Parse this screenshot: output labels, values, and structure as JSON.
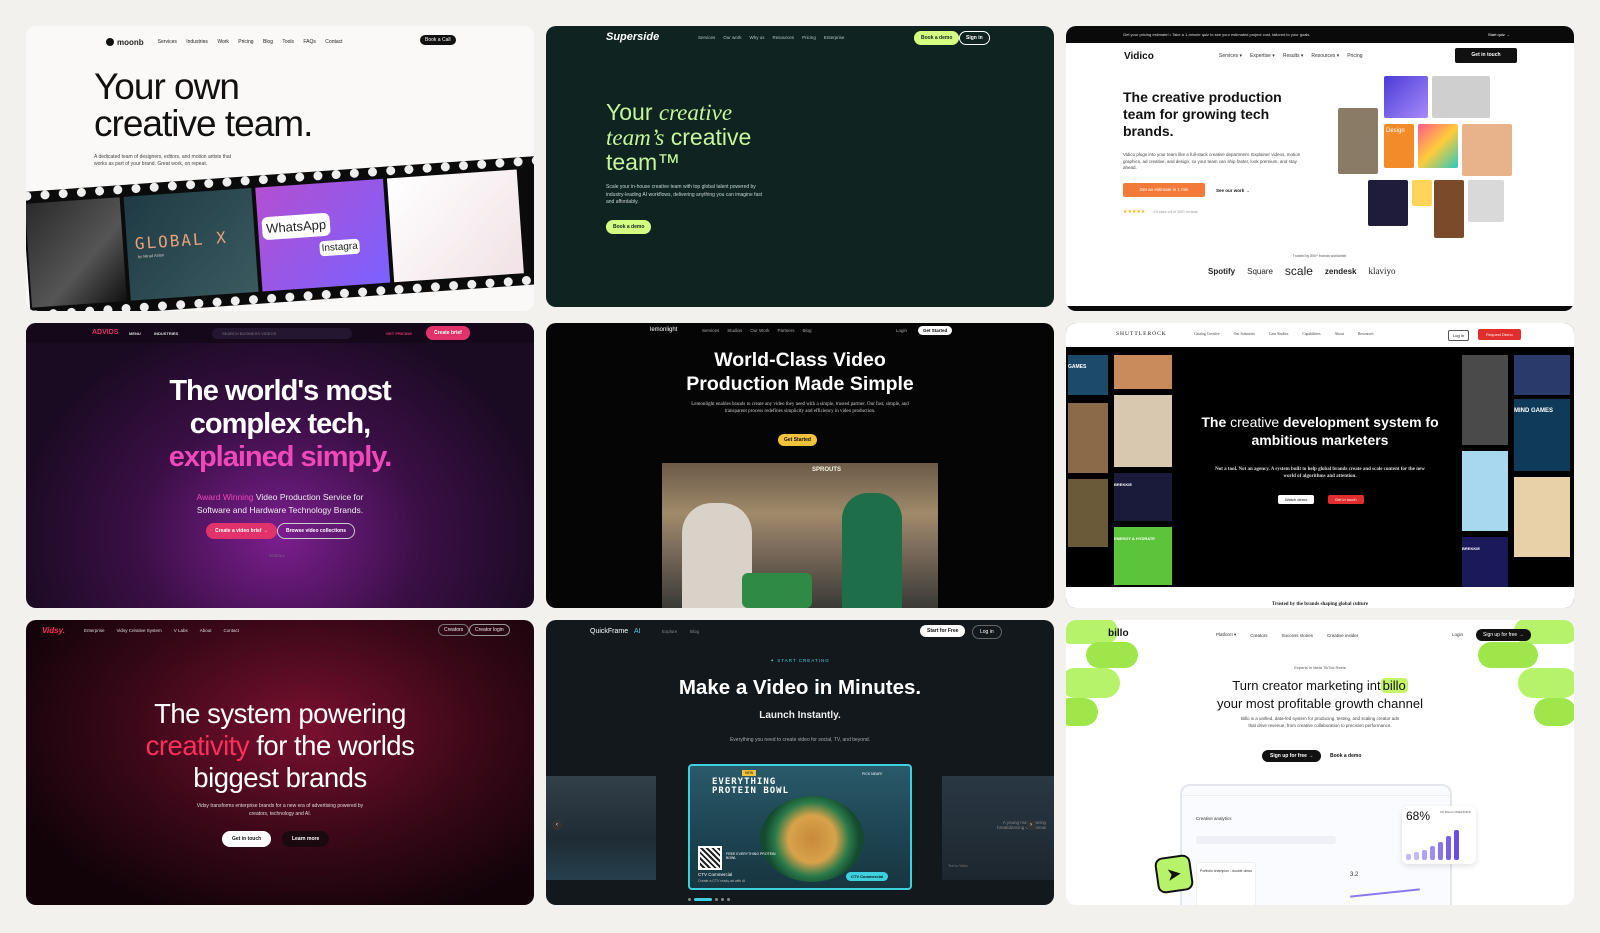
{
  "c1": {
    "logo": "moonb",
    "nav": [
      "Services",
      "Industries",
      "Work",
      "Pricing",
      "Blog",
      "Tools",
      "FAQs",
      "Contact"
    ],
    "cta": "Book a Call",
    "h1a": "Your own",
    "h1b": "creative team.",
    "sub": "A dedicated team of designers, editors, and motion artists that works as part of your brand. Great work, on repeat.",
    "frame2": "GLOBAL X",
    "frame2sub": "by Mirad Aslan",
    "frame3a": "WhatsApp",
    "frame3b": "Instagra"
  },
  "c2": {
    "logo": "Superside",
    "nav": [
      "Services",
      "Our work",
      "Why us",
      "Resources",
      "Pricing",
      "Enterprise"
    ],
    "cta1": "Book a demo",
    "cta2": "Sign in",
    "h1a": "Your ",
    "h1b": "creative",
    "h1c": "team’s",
    "h1d": " creative",
    "h1e": "team™",
    "sub": "Scale your in-house creative team with top global talent powered by industry-leading AI workflows, delivering anything you can imagine fast and affordably.",
    "btn": "Book a demo"
  },
  "c3": {
    "banner": "Get your pricing estimate! • Take a 1-minute quiz to see your estimated project cost, tailored to your goals.",
    "banner_cta": "Start quiz →",
    "logo": "Vidico",
    "nav": [
      "Services ▾",
      "Expertise ▾",
      "Results ▾",
      "Resources ▾",
      "Pricing"
    ],
    "cta": "Get in touch",
    "h1": "The creative production team for growing tech brands.",
    "sub": "Vidico plugs into your team like a full-stack creative department. Explainer videos, motion graphics, ad creative, and design, so your team can ship faster, look premium, and stay ahead.",
    "btn1": "Get an estimate in 1 min",
    "btn2": "See our work →",
    "rating": "★★★★★",
    "rating_text": "4.9 stars out of 100+ reviews",
    "trusted": "Trusted by 500+ brands worldwide.",
    "logos": [
      "Spotify",
      "Square",
      "scale",
      "zendesk",
      "klaviyo"
    ],
    "tile": "Design"
  },
  "c4": {
    "logo": "ADVIDS",
    "menu": "MENU",
    "industries": "INDUSTRIES",
    "search": "SEARCH BUSINESS VIDEOS",
    "pricing": "GET PRICING",
    "cta": "Create brief",
    "h1a": "The world's most",
    "h1b": "complex tech,",
    "h1c": "explained simply.",
    "sub1": "Award Winning",
    "sub2": " Video Production Service for",
    "sub3": "Software and Hardware Technology Brands.",
    "btn1": "Create a video brief →",
    "btn2": "Browse video collections",
    "scroll": "SCROLL"
  },
  "c5": {
    "logo": "lemonlight",
    "nav": [
      "Services",
      "Studios",
      "Our Work",
      "Partners",
      "Blog"
    ],
    "login": "Login",
    "cta": "Get Started",
    "h1a": "World-Class Video",
    "h1b": "Production Made Simple",
    "sub": "Lemonlight enables brands to create any video they need with a simple, trusted partner. Our fast, simple, and transparent process redefines simplicity and efficiency in video production.",
    "btn": "Get Started",
    "sign": "SPROUTS"
  },
  "c6": {
    "logo": "SHUTTLEROCK",
    "nav": [
      "Catalog Creative",
      "Our Solutions",
      "Case Studies",
      "Capabilities",
      "About",
      "Resources"
    ],
    "login": "Log In",
    "cta": "Request Demo",
    "h1a": "The ",
    "h1b": "creative",
    "h1c": " development system fo",
    "h1d": "ambitious marketers",
    "sub": "Not a tool. Not an agency. A system built to help global brands create and scale content for the new world of algorithms and attention.",
    "btn1": "Watch demo",
    "btn2": "Get in touch",
    "trusted": "Trusted by the brands shaping global culture",
    "tiles": [
      "GAMES",
      "BREKKIE",
      "MIND GAMES",
      "ENERGY & HYDRATE",
      "BREKKIE"
    ]
  },
  "c7": {
    "logo": "Vidsy.",
    "nav": [
      "Enterprise",
      "Vidsy Creative System",
      "V Labs",
      "About",
      "Contact"
    ],
    "btn_creators": "Creators",
    "btn_login": "Creator login",
    "h1a": "The system powering",
    "h1b": "creativity",
    "h1c": " for the worlds",
    "h1d": "biggest brands",
    "sub": "Vidsy transforms enterprise brands for a new era of advertising powered by creators, technology and AI.",
    "btn1": "Get in touch",
    "btn2": "Learn more"
  },
  "c8": {
    "logo": "QuickFrame",
    "logo_ai": "AI",
    "nav": [
      "Explore",
      "Blog"
    ],
    "cta1": "Start for Free",
    "cta2": "Log in",
    "kicker": "✦ START CREATING",
    "h1": "Make a Video in Minutes.",
    "h2": "Launch Instantly.",
    "sub": "Everything you need to create video for social, TV, and beyond.",
    "card_new": "NEW",
    "card_title1": "EVERYTHING",
    "card_title2": "PROTEIN BOWL",
    "card_tag": "PICK NEAR!",
    "card_free": "FREE EVERYTHING PROTEIN BOWL",
    "card_type": "CTV Commercial",
    "card_cap": "Create a CTV ready ad with AI",
    "card_badge": "CTV Commercial",
    "right_text": "A young man wearing breakdancing on a snow",
    "right_sub": "Text to Video"
  },
  "c9": {
    "logo": "billo",
    "nav": [
      "Platform ▾",
      "Creators",
      "Success stories",
      "Creative insider"
    ],
    "login": "Login",
    "cta": "Sign up for free →",
    "experts": "Experts in Meta TikTok Reels",
    "h1a": "Turn creator marketing int",
    "h1b": "billo",
    "h1c": "your most profitable growth channel",
    "sub": "Billo is a unified, data-fed system for producing, testing, and scaling creator ads that drive revenue, from creative collaboration to precision performance.",
    "btn1": "Sign up for free →",
    "btn2": "Book a demo",
    "stat": "68%",
    "stat_label": "OF BILLO CREATORS",
    "dash_title": "Creative analytics",
    "dash_row": "Portfolio champion - double down",
    "dash_val": "3.2"
  }
}
